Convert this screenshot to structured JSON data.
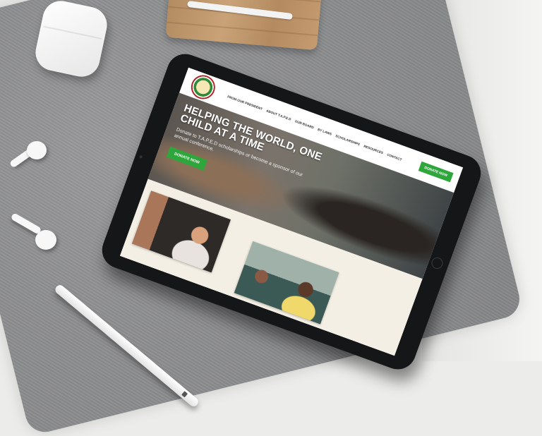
{
  "scene": {
    "description_free": true
  },
  "website": {
    "nav": {
      "items": [
        "FROM OUR PRESIDENT",
        "ABOUT T.A.P.E.D",
        "OUR BOARD",
        "BY LAWS",
        "SCHOLARSHIPS",
        "RESOURCES",
        "CONTACT"
      ],
      "donate_label": "DONATE NOW"
    },
    "hero": {
      "title": "HELPING THE WORLD, ONE CHILD AT A TIME",
      "subtitle": "Donate to T.A.P.E.D scholarships or become a sponsor of our annual conference.",
      "donate_label": "DONATE NOW"
    }
  },
  "colors": {
    "accent_green": "#2fa63c",
    "tablet_bezel": "#151618",
    "felt_mat": "#8d8e90"
  }
}
